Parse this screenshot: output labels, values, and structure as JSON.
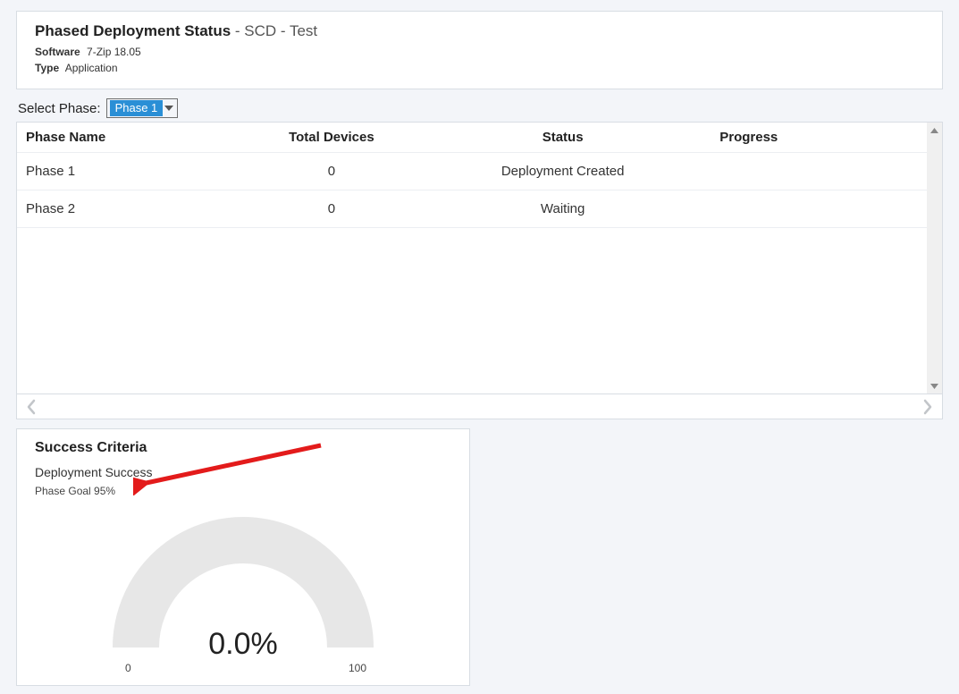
{
  "header": {
    "title_prefix": "Phased Deployment Status",
    "title_suffix": " - SCD - Test",
    "software_label": "Software",
    "software_value": "7-Zip 18.05",
    "type_label": "Type",
    "type_value": "Application"
  },
  "phase_picker": {
    "label": "Select Phase:",
    "selected": "Phase 1"
  },
  "table": {
    "columns": {
      "name": "Phase Name",
      "devices": "Total Devices",
      "status": "Status",
      "progress": "Progress"
    },
    "rows": [
      {
        "name": "Phase 1",
        "devices": "0",
        "status": "Deployment Created",
        "progress": ""
      },
      {
        "name": "Phase 2",
        "devices": "0",
        "status": "Waiting",
        "progress": ""
      }
    ]
  },
  "success": {
    "title": "Success Criteria",
    "sub1": "Deployment Success",
    "sub2": "Phase Goal 95%"
  },
  "chart_data": {
    "type": "gauge",
    "value_percent": 0.0,
    "value_label": "0.0%",
    "min": 0,
    "max": 100,
    "tick_min_label": "0",
    "tick_max_label": "100",
    "goal_percent": 95,
    "title": "Deployment Success"
  }
}
